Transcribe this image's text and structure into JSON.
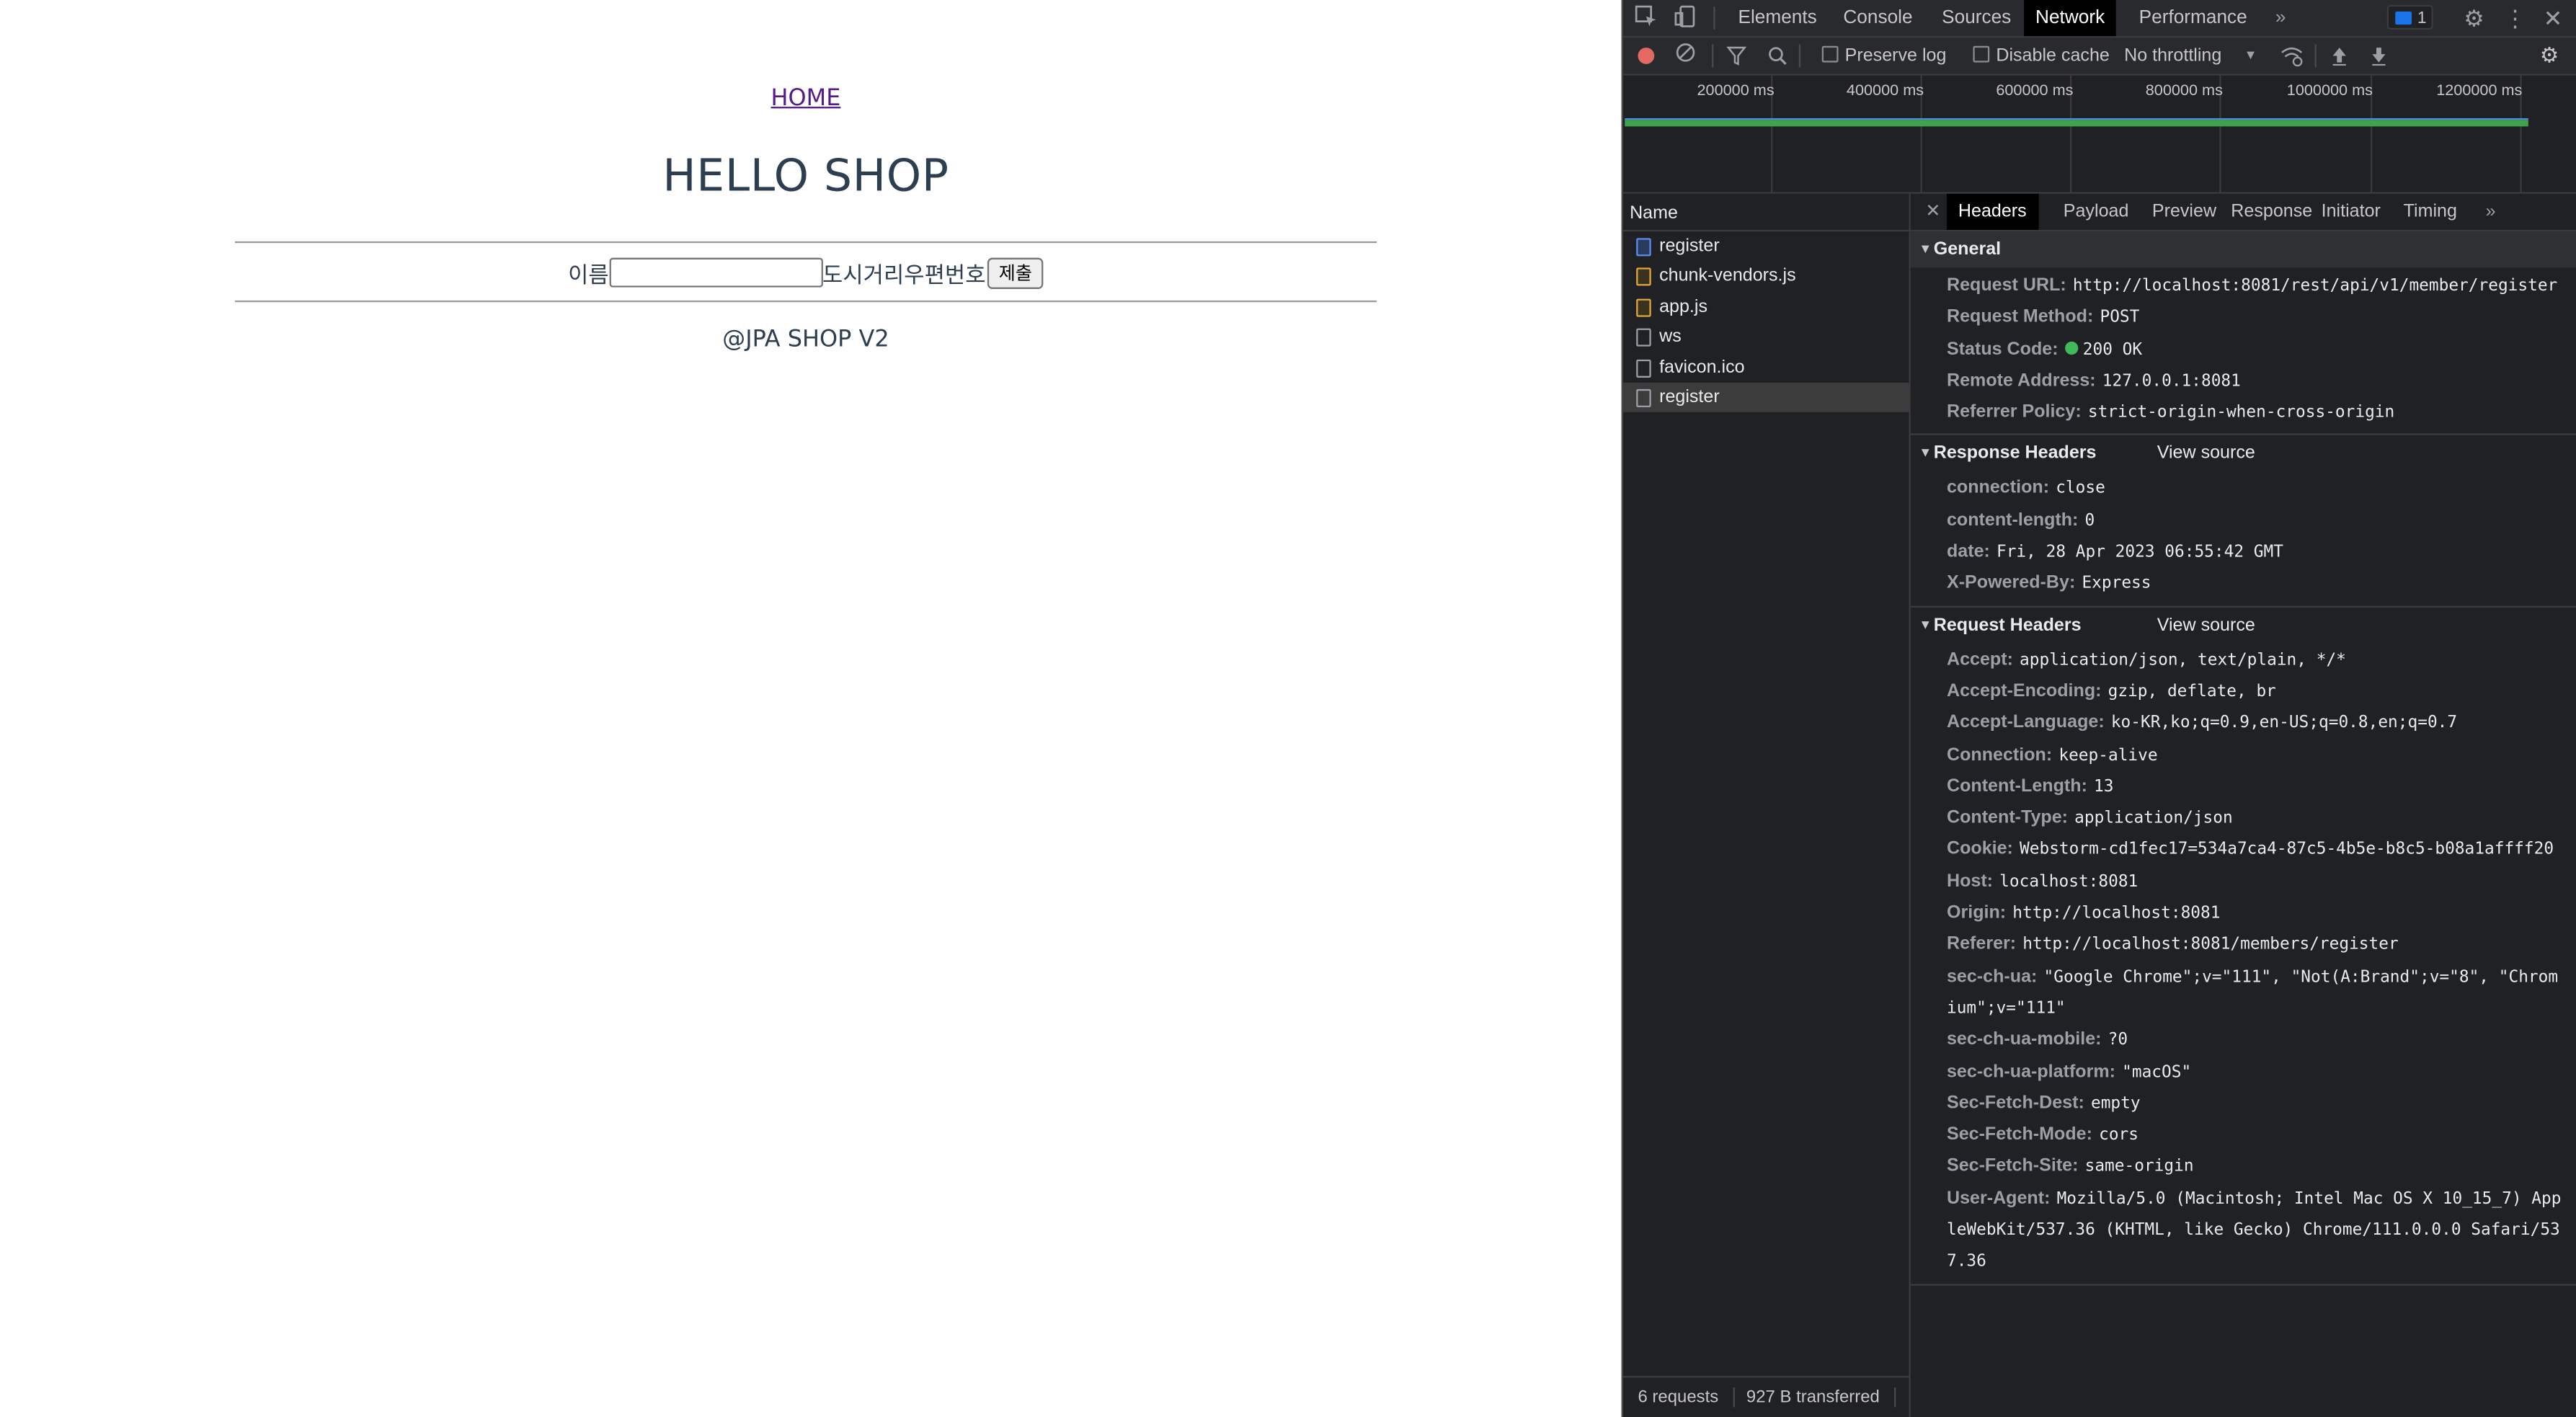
{
  "page": {
    "home_link": "HOME",
    "title": "HELLO SHOP",
    "form": {
      "name_label": "이름",
      "name_value": "",
      "trailing_labels": "도시거리우편번호",
      "submit_label": "제출"
    },
    "footer": "@JPA SHOP V2"
  },
  "devtools": {
    "tabs": [
      "Elements",
      "Console",
      "Sources",
      "Network",
      "Performance"
    ],
    "active_tab": "Network",
    "more_tabs": "»",
    "message_count": "1",
    "toolbar": {
      "preserve_log": "Preserve log",
      "disable_cache": "Disable cache",
      "throttling": "No throttling"
    },
    "overview_ticks": [
      "200000 ms",
      "400000 ms",
      "600000 ms",
      "800000 ms",
      "1000000 ms",
      "1200000 ms"
    ],
    "name_column_header": "Name",
    "requests": [
      {
        "name": "register",
        "type": "doc"
      },
      {
        "name": "chunk-vendors.js",
        "type": "js"
      },
      {
        "name": "app.js",
        "type": "js"
      },
      {
        "name": "ws",
        "type": "other"
      },
      {
        "name": "favicon.ico",
        "type": "other"
      },
      {
        "name": "register",
        "type": "other"
      }
    ],
    "selected_request_index": 5,
    "status": {
      "requests": "6 requests",
      "transferred": "927 B transferred"
    },
    "detail_tabs": [
      "Headers",
      "Payload",
      "Preview",
      "Response",
      "Initiator",
      "Timing"
    ],
    "active_detail_tab": "Headers",
    "general": {
      "title": "General",
      "rows": [
        {
          "k": "Request URL:",
          "v": "http://localhost:8081/rest/api/v1/member/register"
        },
        {
          "k": "Request Method:",
          "v": "POST"
        },
        {
          "k": "Status Code:",
          "v": "200 OK"
        },
        {
          "k": "Remote Address:",
          "v": "127.0.0.1:8081"
        },
        {
          "k": "Referrer Policy:",
          "v": "strict-origin-when-cross-origin"
        }
      ]
    },
    "response_headers": {
      "title": "Response Headers",
      "view_source": "View source",
      "rows": [
        {
          "k": "connection:",
          "v": "close"
        },
        {
          "k": "content-length:",
          "v": "0"
        },
        {
          "k": "date:",
          "v": "Fri, 28 Apr 2023 06:55:42 GMT"
        },
        {
          "k": "X-Powered-By:",
          "v": "Express"
        }
      ]
    },
    "request_headers": {
      "title": "Request Headers",
      "view_source": "View source",
      "rows": [
        {
          "k": "Accept:",
          "v": "application/json, text/plain, */*"
        },
        {
          "k": "Accept-Encoding:",
          "v": "gzip, deflate, br"
        },
        {
          "k": "Accept-Language:",
          "v": "ko-KR,ko;q=0.9,en-US;q=0.8,en;q=0.7"
        },
        {
          "k": "Connection:",
          "v": "keep-alive"
        },
        {
          "k": "Content-Length:",
          "v": "13"
        },
        {
          "k": "Content-Type:",
          "v": "application/json"
        },
        {
          "k": "Cookie:",
          "v": "Webstorm-cd1fec17=534a7ca4-87c5-4b5e-b8c5-b08a1affff20"
        },
        {
          "k": "Host:",
          "v": "localhost:8081"
        },
        {
          "k": "Origin:",
          "v": "http://localhost:8081"
        },
        {
          "k": "Referer:",
          "v": "http://localhost:8081/members/register"
        },
        {
          "k": "sec-ch-ua:",
          "v": "\"Google Chrome\";v=\"111\", \"Not(A:Brand\";v=\"8\", \"Chromium\";v=\"111\""
        },
        {
          "k": "sec-ch-ua-mobile:",
          "v": "?0"
        },
        {
          "k": "sec-ch-ua-platform:",
          "v": "\"macOS\""
        },
        {
          "k": "Sec-Fetch-Dest:",
          "v": "empty"
        },
        {
          "k": "Sec-Fetch-Mode:",
          "v": "cors"
        },
        {
          "k": "Sec-Fetch-Site:",
          "v": "same-origin"
        },
        {
          "k": "User-Agent:",
          "v": "Mozilla/5.0 (Macintosh; Intel Mac OS X 10_15_7) AppleWebKit/537.36 (KHTML, like Gecko) Chrome/111.0.0.0 Safari/537.36"
        }
      ]
    },
    "colors": {
      "status_ok": "#3fbb5b",
      "record": "#e46962",
      "link_visited": "#551a8b",
      "heading": "#2c3e50"
    }
  }
}
